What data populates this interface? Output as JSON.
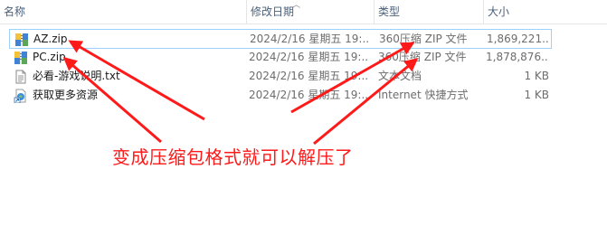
{
  "columns": {
    "name": "名称",
    "date": "修改日期",
    "type": "类型",
    "size": "大小"
  },
  "files": [
    {
      "name": "AZ.zip",
      "date": "2024/2/16 星期五 19:...",
      "type": "360压缩 ZIP 文件",
      "size": "1,869,221...",
      "icon": "zip-archive-icon",
      "selected": true
    },
    {
      "name": "PC.zip",
      "date": "2024/2/16 星期五 19:...",
      "type": "360压缩 ZIP 文件",
      "size": "1,878,876...",
      "icon": "zip-archive-icon",
      "selected": false
    },
    {
      "name": "必看-游戏说明.txt",
      "date": "2024/2/16 星期五 19:...",
      "type": "文本文档",
      "size": "1 KB",
      "icon": "text-file-icon",
      "selected": false
    },
    {
      "name": "获取更多资源",
      "date": "2024/2/16 星期五 19:...",
      "type": "Internet 快捷方式",
      "size": "1 KB",
      "icon": "internet-shortcut-icon",
      "selected": false
    }
  ],
  "annotation": "变成压缩包格式就可以解压了",
  "colors": {
    "annotation": "#ff1a1a",
    "selection_border": "#99d1ff",
    "header_text": "#4c607a"
  }
}
